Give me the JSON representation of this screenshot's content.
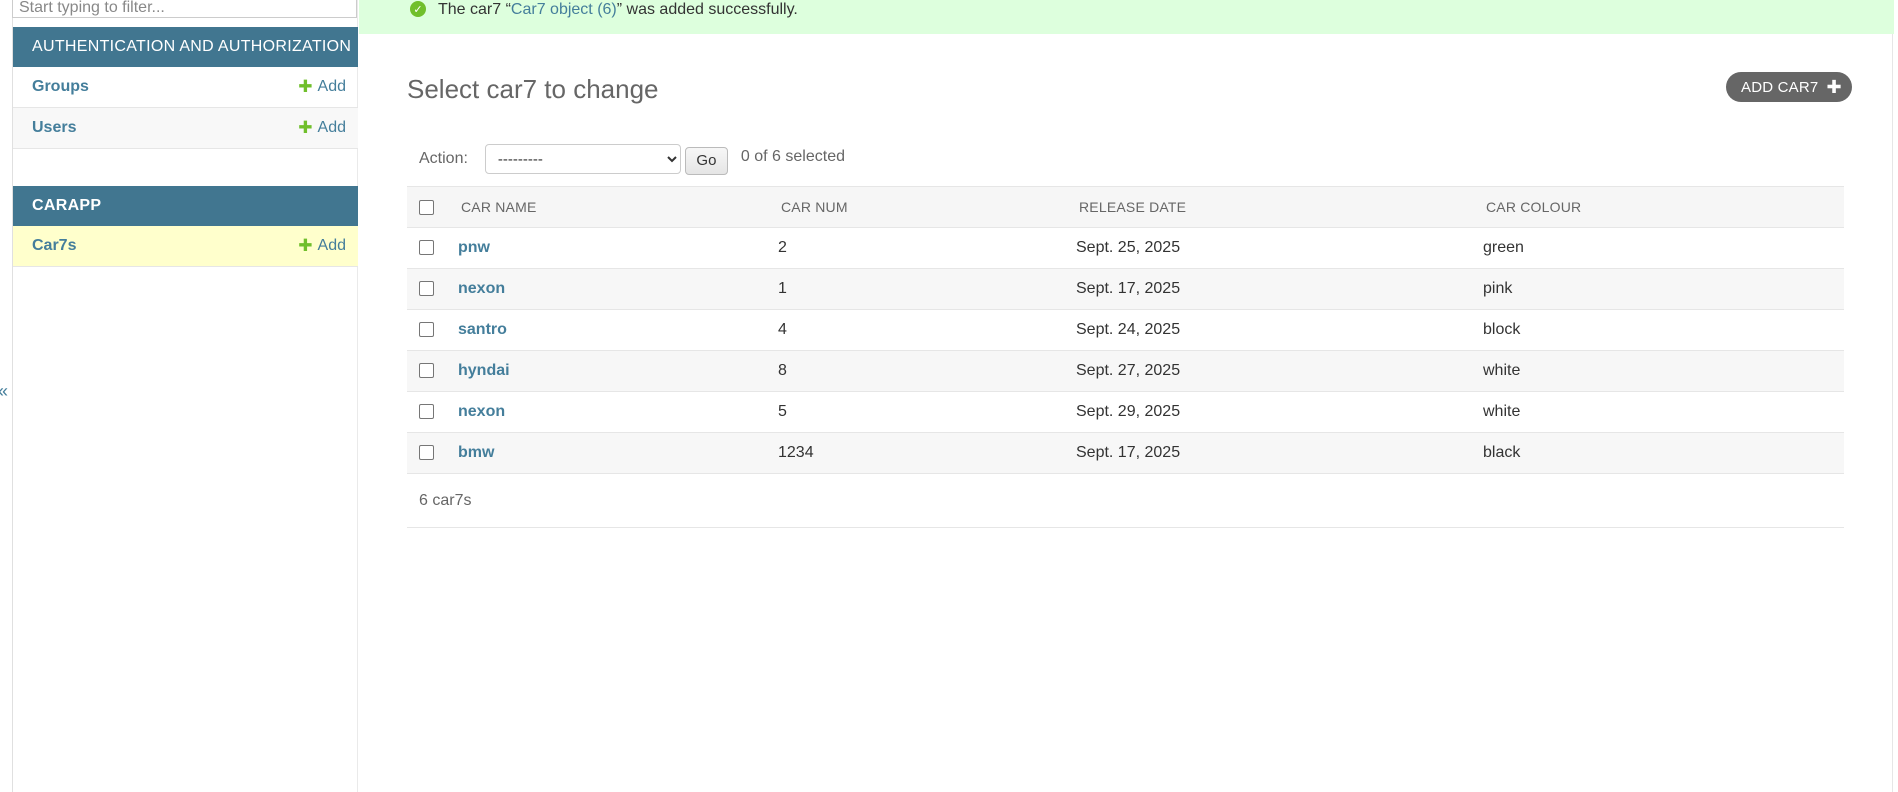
{
  "sidebar": {
    "filter_placeholder": "Start typing to filter...",
    "collapse_glyph": "«",
    "modules": [
      {
        "title": "AUTHENTICATION AND AUTHORIZATION",
        "models": [
          {
            "name": "Groups",
            "add_label": "Add"
          },
          {
            "name": "Users",
            "add_label": "Add"
          }
        ]
      },
      {
        "title": "CARAPP",
        "models": [
          {
            "name": "Car7s",
            "add_label": "Add",
            "current": true
          }
        ]
      }
    ]
  },
  "message": {
    "prefix": "The car7 “",
    "link_text": "Car7 object (6)",
    "suffix": "” was added successfully."
  },
  "page": {
    "title": "Select car7 to change",
    "add_button_label": "ADD CAR7"
  },
  "actions": {
    "label": "Action:",
    "selected_option": "---------",
    "go_label": "Go",
    "selection_count": "0 of 6 selected"
  },
  "table": {
    "headers": [
      "CAR NAME",
      "CAR NUM",
      "RELEASE DATE",
      "CAR COLOUR"
    ],
    "rows": [
      {
        "name": "pnw",
        "num": "2",
        "date": "Sept. 25, 2025",
        "colour": "green"
      },
      {
        "name": "nexon",
        "num": "1",
        "date": "Sept. 17, 2025",
        "colour": "pink"
      },
      {
        "name": "santro",
        "num": "4",
        "date": "Sept. 24, 2025",
        "colour": "block"
      },
      {
        "name": "hyndai",
        "num": "8",
        "date": "Sept. 27, 2025",
        "colour": "white"
      },
      {
        "name": "nexon",
        "num": "5",
        "date": "Sept. 29, 2025",
        "colour": "white"
      },
      {
        "name": "bmw",
        "num": "1234",
        "date": "Sept. 17, 2025",
        "colour": "black"
      }
    ]
  },
  "paginator": {
    "count_text": "6 car7s"
  },
  "colors": {
    "module_header": "#417690",
    "link": "#447e9b",
    "success_bg": "#ddffdd",
    "success_icon": "#70bf2b",
    "current_row": "#ffffcc"
  },
  "icons": {
    "success": "check-circle-icon",
    "add": "plus-icon",
    "collapse": "chevron-double-left-icon"
  }
}
